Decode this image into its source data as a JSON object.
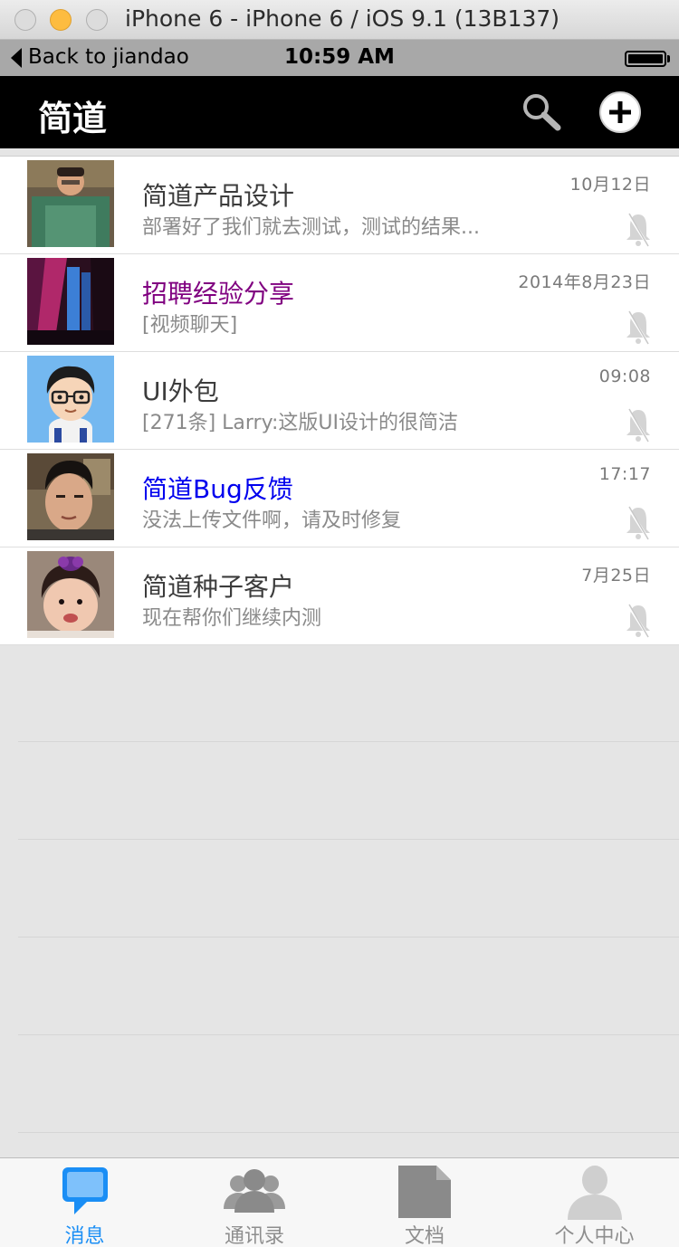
{
  "window": {
    "title": "iPhone 6 - iPhone 6 / iOS 9.1 (13B137)"
  },
  "status_bar": {
    "back_label": "Back to jiandao",
    "time": "10:59 AM"
  },
  "nav": {
    "title": "简道",
    "search_icon": "search-icon",
    "add_icon": "plus-circle-icon"
  },
  "conversations": [
    {
      "title": "简道产品设计",
      "subtitle": "部署好了我们就去测试，测试的结果...",
      "time": "10月12日",
      "title_color": "#3c3c3c",
      "muted": true
    },
    {
      "title": "招聘经验分享",
      "subtitle": "[视频聊天]",
      "time": "2014年8月23日",
      "title_color": "#800080",
      "muted": true
    },
    {
      "title": "UI外包",
      "subtitle": "[271条] Larry:这版UI设计的很简洁",
      "time": "09:08",
      "title_color": "#3c3c3c",
      "muted": true
    },
    {
      "title": "简道Bug反馈",
      "subtitle": "没法上传文件啊，请及时修复",
      "time": "17:17",
      "title_color": "#0000ee",
      "muted": true
    },
    {
      "title": "简道种子客户",
      "subtitle": "现在帮你们继续内测",
      "time": "7月25日",
      "title_color": "#3c3c3c",
      "muted": true
    }
  ],
  "tabs": [
    {
      "label": "消息",
      "icon": "chat-bubble-icon",
      "active": true
    },
    {
      "label": "通讯录",
      "icon": "contacts-icon",
      "active": false
    },
    {
      "label": "文档",
      "icon": "document-icon",
      "active": false
    },
    {
      "label": "个人中心",
      "icon": "person-icon",
      "active": false
    }
  ],
  "colors": {
    "accent": "#1a8ef5",
    "nav_background": "#000000",
    "list_background": "#e5e5e5"
  }
}
